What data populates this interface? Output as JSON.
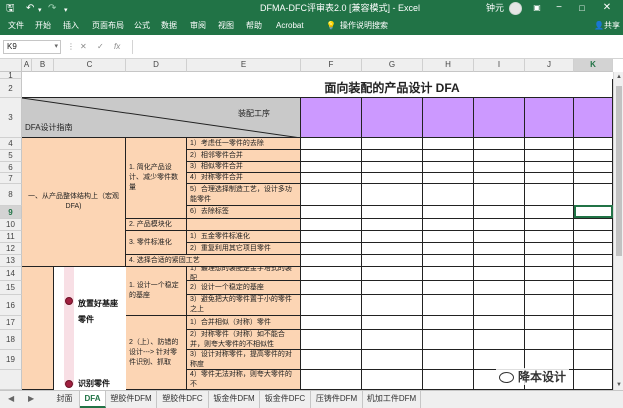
{
  "window": {
    "title": "DFMA-DFC评审表2.0  [兼容模式]  -  Excel",
    "user": "钟元",
    "controls": [
      "minimize-icon",
      "restore-icon",
      "close-icon"
    ]
  },
  "quick_access": [
    "save-icon",
    "undo-icon",
    "redo-icon",
    "customize-icon"
  ],
  "ribbon": {
    "tabs": [
      "文件",
      "开始",
      "插入",
      "页面布局",
      "公式",
      "数据",
      "审阅",
      "视图",
      "帮助",
      "Acrobat"
    ],
    "search": "操作说明搜索",
    "share": "共享"
  },
  "formula_bar": {
    "name_box": "K9",
    "fx": "fx",
    "value": ""
  },
  "columns": [
    "A",
    "B",
    "C",
    "D",
    "E",
    "F",
    "G",
    "H",
    "I",
    "J",
    "K"
  ],
  "selected_column": "K",
  "rows": [
    "1",
    "2",
    "3",
    "4",
    "5",
    "6",
    "7",
    "8",
    "9",
    "10",
    "11",
    "12",
    "13",
    "14",
    "15",
    "16",
    "17",
    "18",
    "19"
  ],
  "selected_row": "9",
  "sheet": {
    "title": "面向装配的产品设计 DFA",
    "header_top_right": "装配工序",
    "header_bottom_left": "DFA设计指南",
    "group1": "一、从产品整体结构上（宏观DFA)",
    "sub1": "1. 简化产品设计、减少零件数量",
    "sub2": "2. 产品模块化",
    "sub3": "3. 零件标准化",
    "sub4": "4. 选择合适的紧固工艺",
    "items": [
      "1）考虑任一零件的去除",
      "2）相邻零件合并",
      "3）相似零件合并",
      "4）对称零件合并",
      "5）合理选择制造工艺，设计多功能零件",
      "6）去除标签",
      "",
      "1）五金零件标准化",
      "2）重复利用其它项目零件",
      "",
      "1）最理想的装配是金字塔式的装配",
      "2）设计一个稳定的基座",
      "3）避免把大的零件置于小的零件之上",
      "1）合并相似（对称）零件",
      "2）对称零件（对称）如不能合并，则夸大零件的不相似性",
      "3）设计对称零件，提高零件的对称度",
      "4）零件无法对称，则夸大零件的不"
    ],
    "base_sub1": "1. 设计一个稳定的基座",
    "base_sub2": "2（上）、防错的设计---> 针对零件识别、抓取",
    "ink_text1": "放置好基座零件",
    "ink_text2": "识别零件"
  },
  "sheet_tabs": [
    "封面",
    "DFA",
    "塑胶件DFM",
    "塑胶件DFC",
    "钣金件DFM",
    "钣金件DFC",
    "压铸件DFM",
    "机加工件DFM"
  ],
  "active_sheet": "DFA",
  "watermark": "降本设计",
  "colors": {
    "excel_green": "#217346",
    "header_purple": "#cc99ff",
    "guide_peach": "#fcd5b4",
    "diag_grey": "#c9c9c9"
  }
}
